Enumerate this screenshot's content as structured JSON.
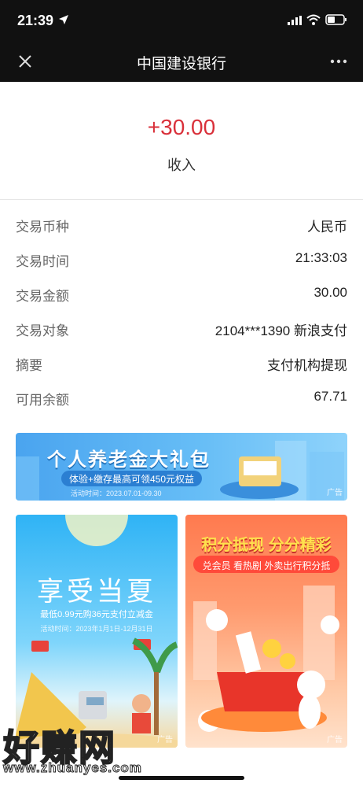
{
  "status": {
    "time": "21:39"
  },
  "nav": {
    "title": "中国建设银行"
  },
  "transaction": {
    "amount": "+30.00",
    "type": "收入"
  },
  "details": [
    {
      "label": "交易币种",
      "value": "人民币"
    },
    {
      "label": "交易时间",
      "value": "21:33:03"
    },
    {
      "label": "交易金额",
      "value": "30.00"
    },
    {
      "label": "交易对象",
      "value": "2104***1390 新浪支付"
    },
    {
      "label": "摘要",
      "value": "支付机构提现"
    },
    {
      "label": "可用余额",
      "value": "67.71"
    }
  ],
  "ads": {
    "banner": {
      "title": "个人养老金大礼包",
      "subtitle": "体验+缴存最高可领450元权益",
      "date": "活动时间：2023.07.01-09.30",
      "tag": "广告"
    },
    "left_card": {
      "title": "享受当夏",
      "subtitle": "最低0.99元购36元支付立减金",
      "date": "活动时间：2023年1月1日-12月31日",
      "tag": "广告"
    },
    "right_card": {
      "title": "积分抵现 分分精彩",
      "subtitle": "兑会员 看热剧 外卖出行积分抵",
      "tag": "广告"
    }
  },
  "watermark": {
    "text": "好赚网",
    "url": "www.zhuanyes.com"
  },
  "colors": {
    "amount": "#d9303a",
    "header": "#111111"
  }
}
